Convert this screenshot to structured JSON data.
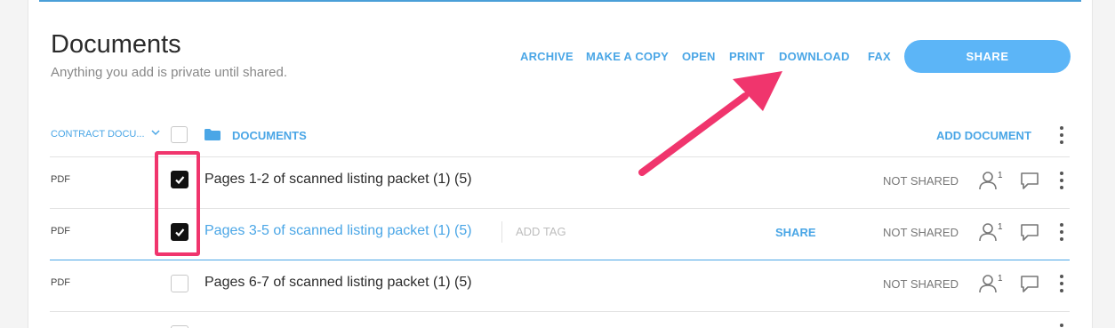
{
  "header": {
    "title": "Documents",
    "subtitle": "Anything you add is private until shared."
  },
  "toolbar": {
    "archive": "ARCHIVE",
    "make_copy": "MAKE A COPY",
    "open": "OPEN",
    "print": "PRINT",
    "download": "DOWNLOAD",
    "fax": "FAX",
    "share": "SHARE"
  },
  "table_header": {
    "type_column": "CONTRACT DOCU...",
    "documents": "DOCUMENTS",
    "add_document": "ADD DOCUMENT"
  },
  "rows": [
    {
      "type": "PDF",
      "name": "Pages 1-2 of scanned listing packet (1) (5)",
      "checked": true,
      "status": "NOT SHARED",
      "user_count": "1"
    },
    {
      "type": "PDF",
      "name": "Pages 3-5 of scanned listing packet (1) (5)",
      "checked": true,
      "tag": "ADD TAG",
      "share": "SHARE",
      "status": "NOT SHARED",
      "user_count": "1"
    },
    {
      "type": "PDF",
      "name": "Pages 6-7 of scanned listing packet (1) (5)",
      "checked": false,
      "status": "NOT SHARED",
      "user_count": "1"
    }
  ],
  "colors": {
    "accent": "#4aa6e6",
    "share_button": "#5cb5f7",
    "annotation": "#f0356d",
    "checked_box": "#111111"
  },
  "icons": [
    "chevron-down-icon",
    "folder-icon",
    "check-icon",
    "user-icon",
    "comment-icon",
    "more-vertical-icon",
    "arrow-annotation"
  ]
}
